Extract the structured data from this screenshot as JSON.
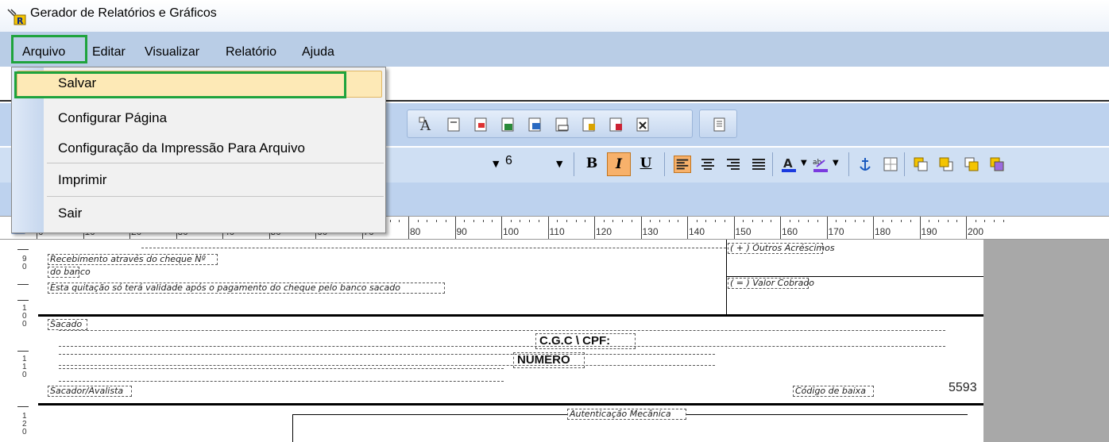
{
  "window": {
    "title": "Gerador de Relatórios e Gráficos"
  },
  "menubar": {
    "items": [
      "Arquivo",
      "Editar",
      "Visualizar",
      "Relatório",
      "Ajuda"
    ]
  },
  "arquivo_menu": {
    "items": [
      "Salvar",
      "Configurar Página",
      "Configuração da Impressão Para Arquivo",
      "Imprimir",
      "Sair"
    ]
  },
  "toolbar": {
    "font_size": "6",
    "bold": "B",
    "italic": "I",
    "underline": "U"
  },
  "ruler": {
    "labels": [
      "0",
      "10",
      "20",
      "30",
      "40",
      "50",
      "60",
      "70",
      "80",
      "90",
      "100",
      "110",
      "120",
      "130",
      "140",
      "150",
      "160",
      "170",
      "180",
      "190",
      "200"
    ]
  },
  "vruler": {
    "labels": [
      "9\n0",
      "1\n0\n0",
      "1\n1\n0",
      "1\n2\n0"
    ]
  },
  "report": {
    "recebimento": "Recebimento através do cheque Nº",
    "do_banco": "do banco",
    "quitacao": "Esta quitação só terá validade após o pagamento do cheque pelo banco sacado",
    "outros_acrescimos": "( + ) Outros Acréscimos",
    "valor_cobrado": "( = ) Valor Cobrado",
    "sacado": "Sacado",
    "cgc_cpf": "C.G.C \\ CPF:",
    "numero": "NUMERO",
    "sacador_avalista": "Sacador/Avalista",
    "codigo_baixa": "Código de baixa",
    "code_value": "5593",
    "autenticacao": "Autenticação Mecânica"
  },
  "colors": {
    "menubar": "#b9cde6",
    "highlight": "#1fa33d",
    "selected_item": "#fde9b6"
  }
}
